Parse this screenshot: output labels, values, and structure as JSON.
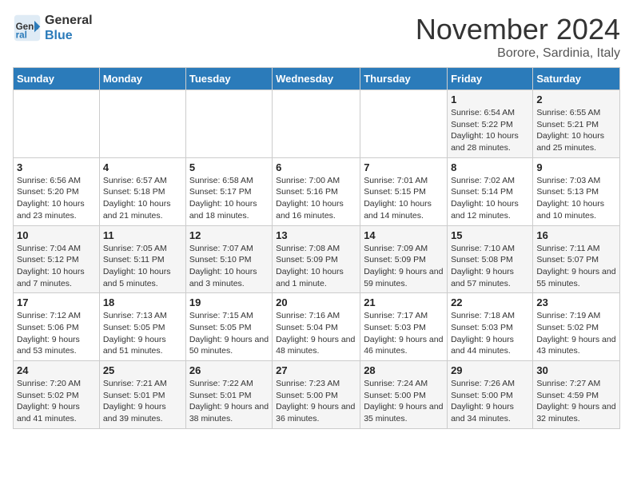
{
  "header": {
    "logo_line1": "General",
    "logo_line2": "Blue",
    "month": "November 2024",
    "location": "Borore, Sardinia, Italy"
  },
  "days_of_week": [
    "Sunday",
    "Monday",
    "Tuesday",
    "Wednesday",
    "Thursday",
    "Friday",
    "Saturday"
  ],
  "weeks": [
    [
      {
        "day": "",
        "info": ""
      },
      {
        "day": "",
        "info": ""
      },
      {
        "day": "",
        "info": ""
      },
      {
        "day": "",
        "info": ""
      },
      {
        "day": "",
        "info": ""
      },
      {
        "day": "1",
        "info": "Sunrise: 6:54 AM\nSunset: 5:22 PM\nDaylight: 10 hours and 28 minutes."
      },
      {
        "day": "2",
        "info": "Sunrise: 6:55 AM\nSunset: 5:21 PM\nDaylight: 10 hours and 25 minutes."
      }
    ],
    [
      {
        "day": "3",
        "info": "Sunrise: 6:56 AM\nSunset: 5:20 PM\nDaylight: 10 hours and 23 minutes."
      },
      {
        "day": "4",
        "info": "Sunrise: 6:57 AM\nSunset: 5:18 PM\nDaylight: 10 hours and 21 minutes."
      },
      {
        "day": "5",
        "info": "Sunrise: 6:58 AM\nSunset: 5:17 PM\nDaylight: 10 hours and 18 minutes."
      },
      {
        "day": "6",
        "info": "Sunrise: 7:00 AM\nSunset: 5:16 PM\nDaylight: 10 hours and 16 minutes."
      },
      {
        "day": "7",
        "info": "Sunrise: 7:01 AM\nSunset: 5:15 PM\nDaylight: 10 hours and 14 minutes."
      },
      {
        "day": "8",
        "info": "Sunrise: 7:02 AM\nSunset: 5:14 PM\nDaylight: 10 hours and 12 minutes."
      },
      {
        "day": "9",
        "info": "Sunrise: 7:03 AM\nSunset: 5:13 PM\nDaylight: 10 hours and 10 minutes."
      }
    ],
    [
      {
        "day": "10",
        "info": "Sunrise: 7:04 AM\nSunset: 5:12 PM\nDaylight: 10 hours and 7 minutes."
      },
      {
        "day": "11",
        "info": "Sunrise: 7:05 AM\nSunset: 5:11 PM\nDaylight: 10 hours and 5 minutes."
      },
      {
        "day": "12",
        "info": "Sunrise: 7:07 AM\nSunset: 5:10 PM\nDaylight: 10 hours and 3 minutes."
      },
      {
        "day": "13",
        "info": "Sunrise: 7:08 AM\nSunset: 5:09 PM\nDaylight: 10 hours and 1 minute."
      },
      {
        "day": "14",
        "info": "Sunrise: 7:09 AM\nSunset: 5:09 PM\nDaylight: 9 hours and 59 minutes."
      },
      {
        "day": "15",
        "info": "Sunrise: 7:10 AM\nSunset: 5:08 PM\nDaylight: 9 hours and 57 minutes."
      },
      {
        "day": "16",
        "info": "Sunrise: 7:11 AM\nSunset: 5:07 PM\nDaylight: 9 hours and 55 minutes."
      }
    ],
    [
      {
        "day": "17",
        "info": "Sunrise: 7:12 AM\nSunset: 5:06 PM\nDaylight: 9 hours and 53 minutes."
      },
      {
        "day": "18",
        "info": "Sunrise: 7:13 AM\nSunset: 5:05 PM\nDaylight: 9 hours and 51 minutes."
      },
      {
        "day": "19",
        "info": "Sunrise: 7:15 AM\nSunset: 5:05 PM\nDaylight: 9 hours and 50 minutes."
      },
      {
        "day": "20",
        "info": "Sunrise: 7:16 AM\nSunset: 5:04 PM\nDaylight: 9 hours and 48 minutes."
      },
      {
        "day": "21",
        "info": "Sunrise: 7:17 AM\nSunset: 5:03 PM\nDaylight: 9 hours and 46 minutes."
      },
      {
        "day": "22",
        "info": "Sunrise: 7:18 AM\nSunset: 5:03 PM\nDaylight: 9 hours and 44 minutes."
      },
      {
        "day": "23",
        "info": "Sunrise: 7:19 AM\nSunset: 5:02 PM\nDaylight: 9 hours and 43 minutes."
      }
    ],
    [
      {
        "day": "24",
        "info": "Sunrise: 7:20 AM\nSunset: 5:02 PM\nDaylight: 9 hours and 41 minutes."
      },
      {
        "day": "25",
        "info": "Sunrise: 7:21 AM\nSunset: 5:01 PM\nDaylight: 9 hours and 39 minutes."
      },
      {
        "day": "26",
        "info": "Sunrise: 7:22 AM\nSunset: 5:01 PM\nDaylight: 9 hours and 38 minutes."
      },
      {
        "day": "27",
        "info": "Sunrise: 7:23 AM\nSunset: 5:00 PM\nDaylight: 9 hours and 36 minutes."
      },
      {
        "day": "28",
        "info": "Sunrise: 7:24 AM\nSunset: 5:00 PM\nDaylight: 9 hours and 35 minutes."
      },
      {
        "day": "29",
        "info": "Sunrise: 7:26 AM\nSunset: 5:00 PM\nDaylight: 9 hours and 34 minutes."
      },
      {
        "day": "30",
        "info": "Sunrise: 7:27 AM\nSunset: 4:59 PM\nDaylight: 9 hours and 32 minutes."
      }
    ]
  ]
}
